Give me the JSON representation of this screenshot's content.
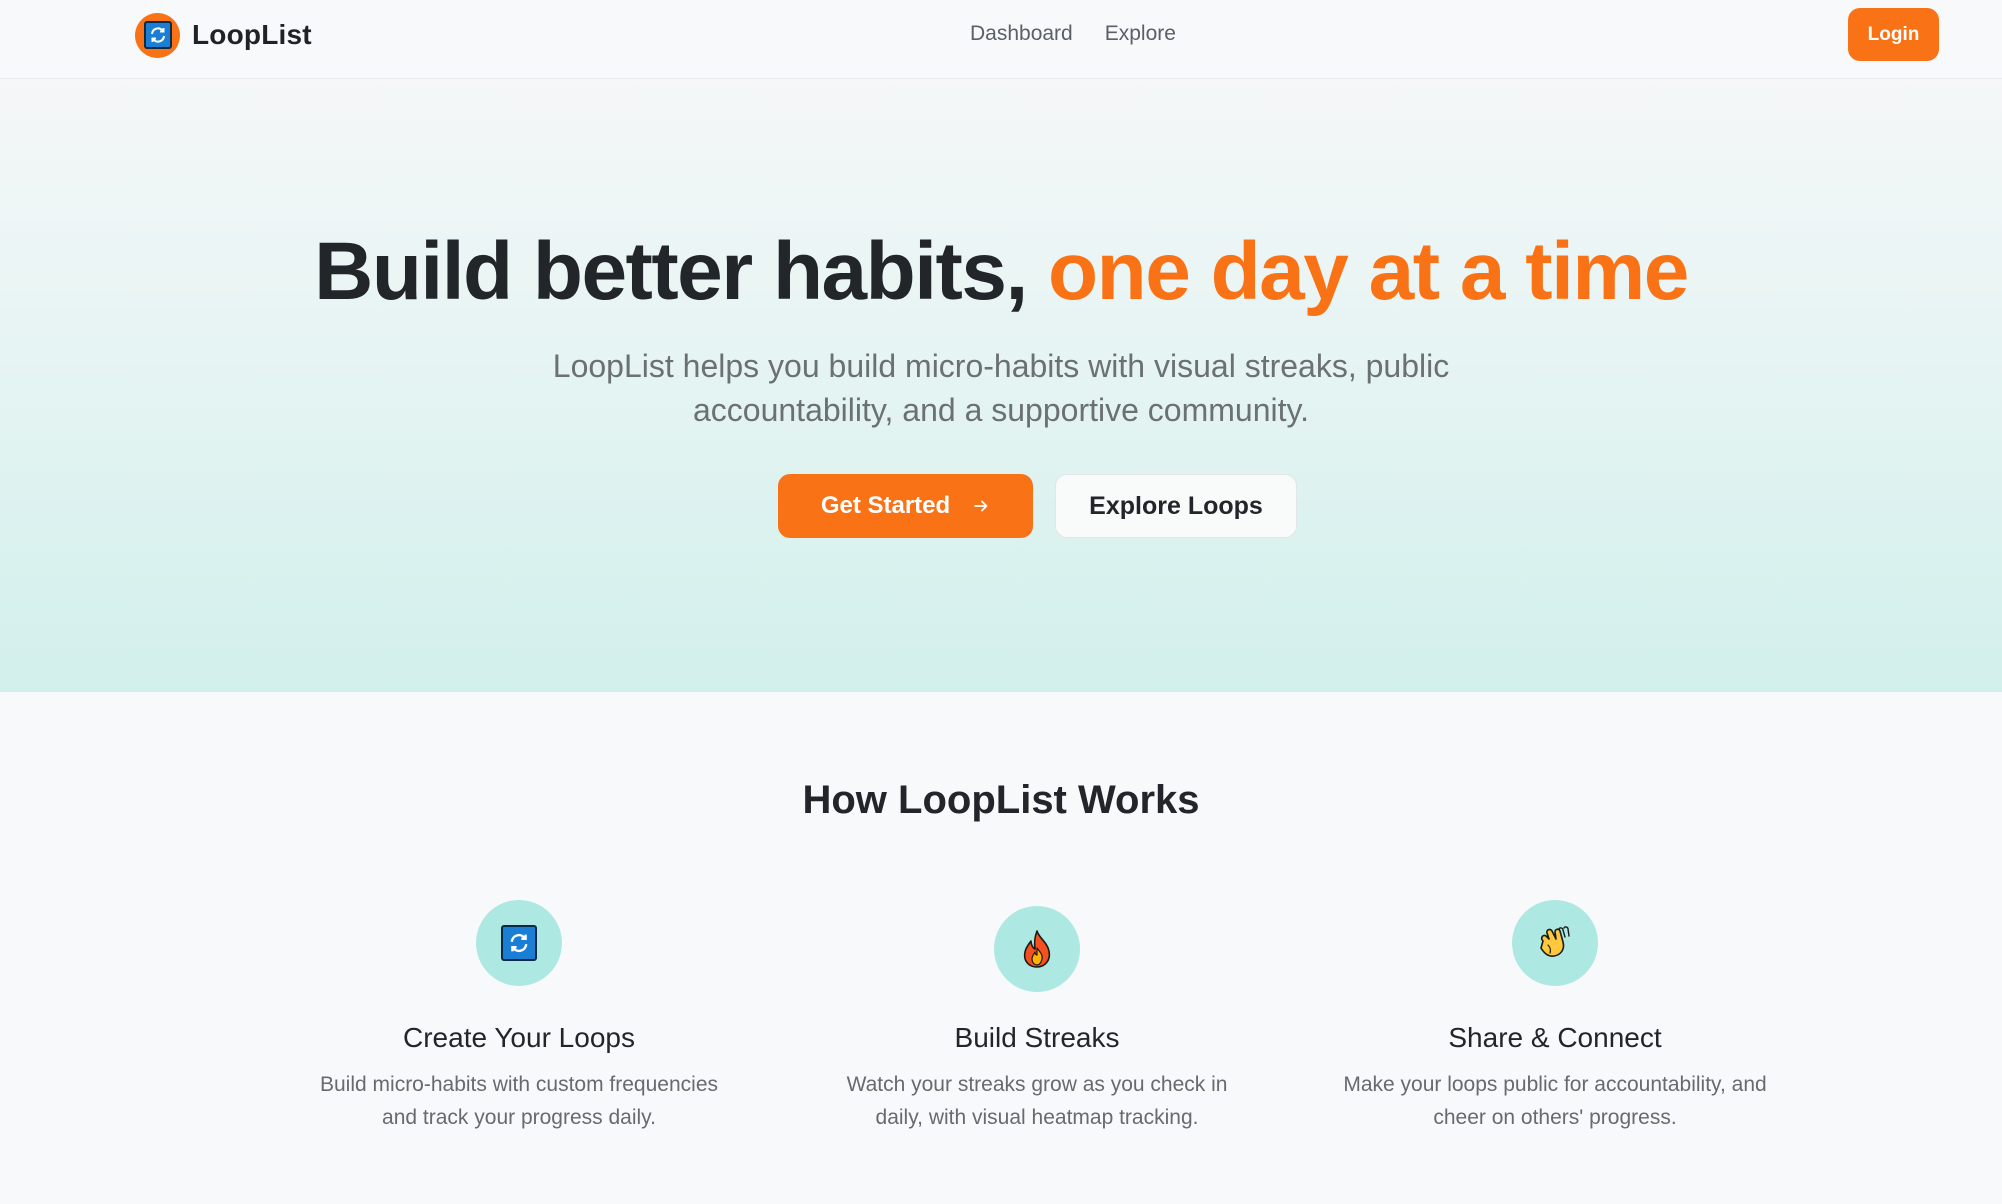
{
  "header": {
    "brand": "LoopList",
    "nav": [
      {
        "label": "Dashboard"
      },
      {
        "label": "Explore"
      }
    ],
    "login_label": "Login"
  },
  "hero": {
    "title_main": "Build better habits,",
    "title_accent": "one day at a time",
    "subtitle": "LoopList helps you build micro-habits with visual streaks, public accountability, and a supportive community.",
    "primary_cta": "Get Started",
    "secondary_cta": "Explore Loops"
  },
  "features": {
    "title": "How LoopList Works",
    "items": [
      {
        "icon": "loop-arrows-icon",
        "title": "Create Your Loops",
        "desc": "Build micro-habits with custom frequencies and track your progress daily."
      },
      {
        "icon": "fire-icon",
        "title": "Build Streaks",
        "desc": "Watch your streaks grow as you check in daily, with visual heatmap tracking."
      },
      {
        "icon": "clapping-hands-icon",
        "title": "Share & Connect",
        "desc": "Make your loops public for accountability, and cheer on others' progress."
      }
    ]
  },
  "colors": {
    "accent": "#f97316",
    "feature_icon_bg": "#aee8e2",
    "hero_gradient_end": "#d2f0ec"
  }
}
